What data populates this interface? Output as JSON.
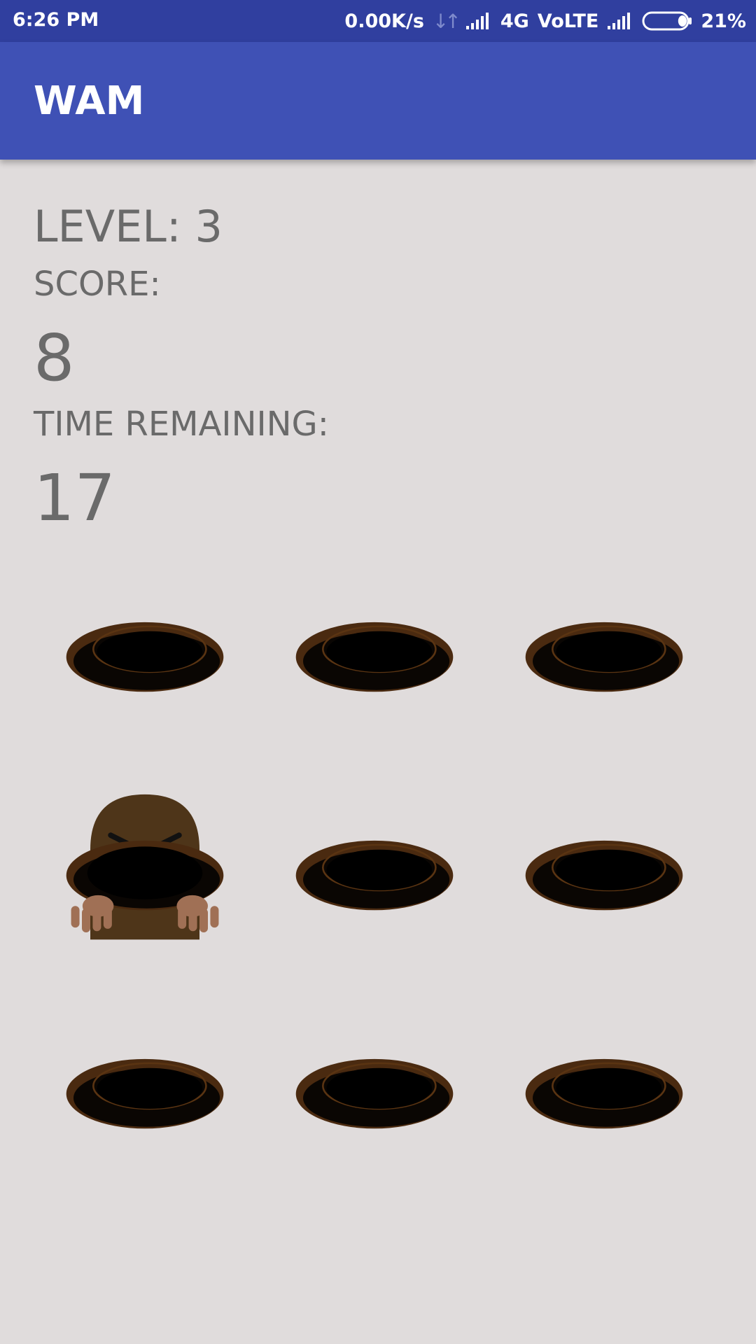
{
  "status_bar": {
    "time": "6:26 PM",
    "net_speed": "0.00K/s",
    "network_type": "4G",
    "volte": "VoLTE",
    "battery_percent": "21%",
    "battery_level": 0.21,
    "icons": [
      "data-arrows-icon",
      "signal-icon",
      "signal-icon",
      "battery-icon"
    ]
  },
  "app_bar": {
    "title": "WAM",
    "color": "#3f51b5"
  },
  "game": {
    "level_label": "LEVEL: 3",
    "score_label": "SCORE:",
    "score_value": "8",
    "time_label": "TIME REMAINING:",
    "time_value": "17",
    "holes": [
      {
        "row": 1,
        "col": 1,
        "mole": false
      },
      {
        "row": 1,
        "col": 2,
        "mole": false
      },
      {
        "row": 1,
        "col": 3,
        "mole": false
      },
      {
        "row": 2,
        "col": 1,
        "mole": true
      },
      {
        "row": 2,
        "col": 2,
        "mole": false
      },
      {
        "row": 2,
        "col": 3,
        "mole": false
      },
      {
        "row": 3,
        "col": 1,
        "mole": false
      },
      {
        "row": 3,
        "col": 2,
        "mole": false
      },
      {
        "row": 3,
        "col": 3,
        "mole": false
      }
    ]
  },
  "colors": {
    "background": "#e0dcdc",
    "status_bar": "#303f9f",
    "hole_rim": "#4a2a10",
    "mole_body": "#4e3519",
    "mole_paw": "#a07055"
  }
}
